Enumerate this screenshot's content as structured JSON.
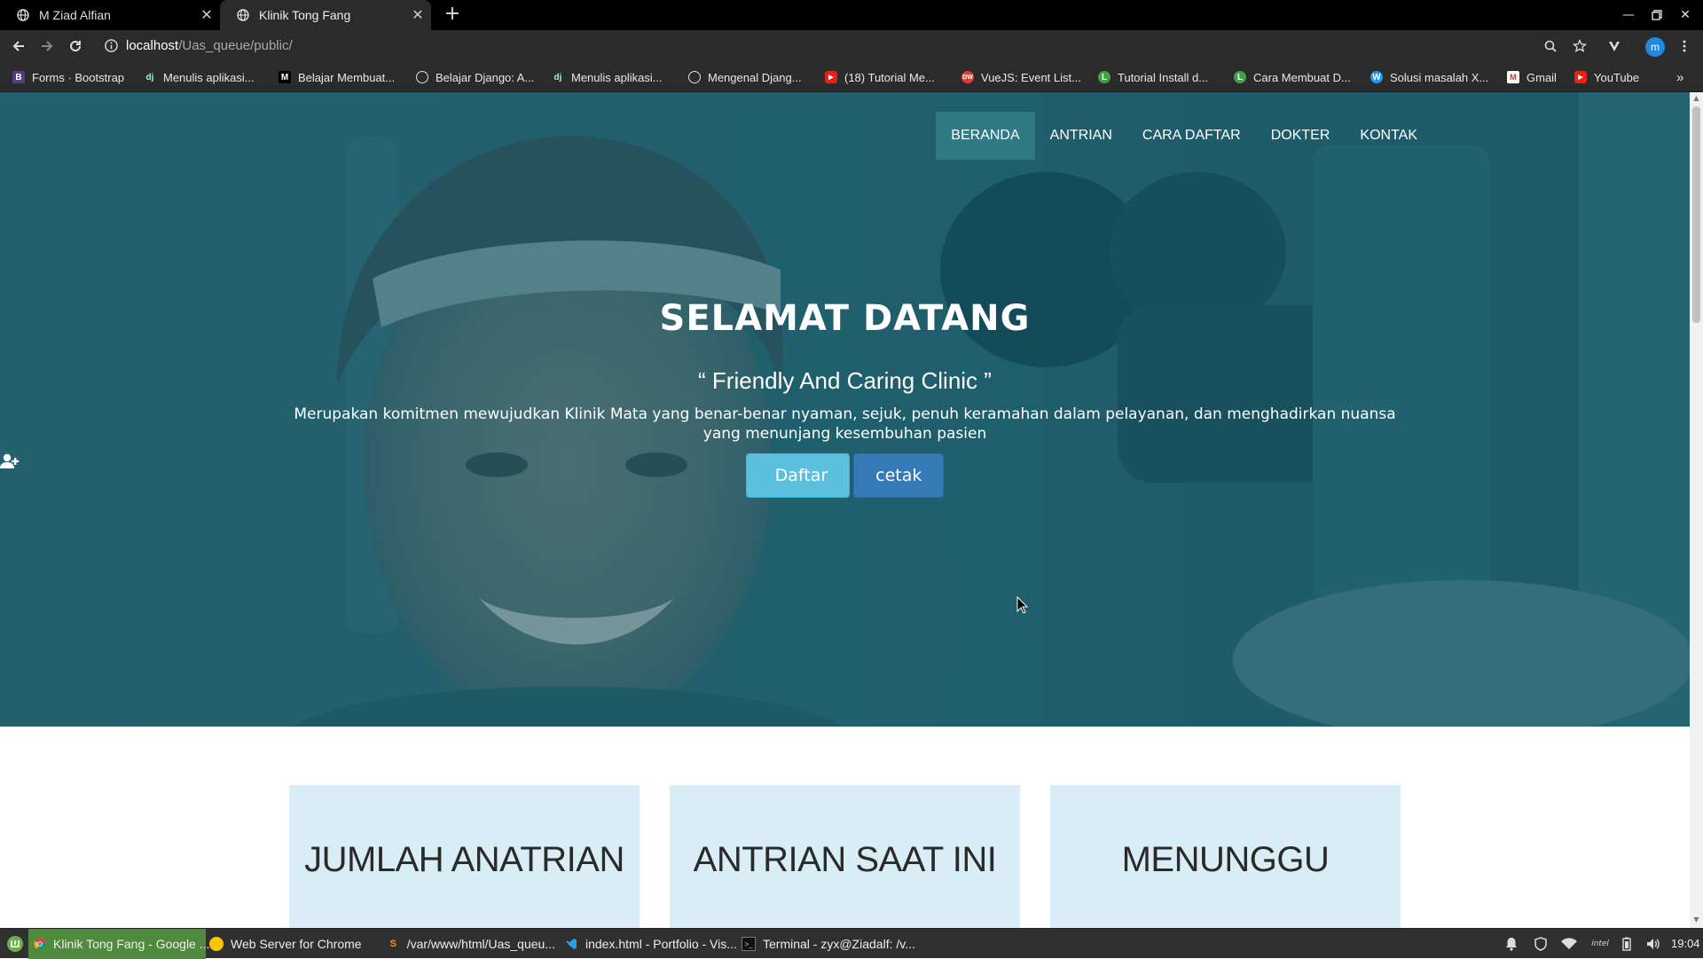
{
  "browser": {
    "tabs": [
      {
        "title": "M Ziad Alfian",
        "active": false
      },
      {
        "title": "Klinik Tong Fang",
        "active": true
      }
    ],
    "new_tab": "+",
    "url_host": "localhost",
    "url_path": "/Uas_queue/public/",
    "profile_initial": "m",
    "bookmarks": [
      {
        "label": "Forms · Bootstrap",
        "icon": "B"
      },
      {
        "label": "Menulis aplikasi...",
        "icon": "dj"
      },
      {
        "label": "Belajar Membuat...",
        "icon": "M"
      },
      {
        "label": "Belajar Django: A...",
        "icon": "globe"
      },
      {
        "label": "Menulis aplikasi...",
        "icon": "dj"
      },
      {
        "label": "Mengenal Djang...",
        "icon": "globe"
      },
      {
        "label": "(18) Tutorial Me...",
        "icon": "youtube"
      },
      {
        "label": "VueJS: Event List...",
        "icon": "DW"
      },
      {
        "label": "Tutorial Install d...",
        "icon": "L"
      },
      {
        "label": "Cara Membuat D...",
        "icon": "L"
      },
      {
        "label": "Solusi masalah X...",
        "icon": "W"
      },
      {
        "label": "Gmail",
        "icon": "gmail"
      },
      {
        "label": "YouTube",
        "icon": "youtube"
      }
    ],
    "bookmarks_more": "»"
  },
  "site": {
    "nav": [
      {
        "label": "BERANDA",
        "active": true
      },
      {
        "label": "ANTRIAN",
        "active": false
      },
      {
        "label": "CARA DAFTAR",
        "active": false
      },
      {
        "label": "DOKTER",
        "active": false
      },
      {
        "label": "KONTAK",
        "active": false
      }
    ],
    "hero": {
      "title": "SELAMAT DATANG",
      "subtitle": "“ Friendly And Caring Clinic ”",
      "description": "Merupakan komitmen mewujudkan Klinik Mata yang benar-benar nyaman, sejuk, penuh keramahan dalam pelayanan, dan menghadirkan nuansa yang menunjang kesembuhan pasien",
      "daftar_label": "Daftar",
      "cetak_label": "cetak"
    },
    "cards": [
      {
        "label": "JUMLAH ANATRIAN"
      },
      {
        "label": "ANTRIAN SAAT INI"
      },
      {
        "label": "MENUNGGU"
      }
    ]
  },
  "taskbar": {
    "items": [
      {
        "label": "Klinik Tong Fang - Google ...",
        "active": true
      },
      {
        "label": "Web Server for Chrome",
        "active": false
      },
      {
        "label": "/var/www/html/Uas_queu...",
        "active": false
      },
      {
        "label": "index.html - Portfolio - Vis...",
        "active": false
      },
      {
        "label": "Terminal - zyx@Ziadalf: /v...",
        "active": false
      }
    ],
    "clock": "19:04"
  },
  "colors": {
    "hero_overlay": "#1f6a78",
    "nav_active": "#2d7a82",
    "btn_daftar": "#5bc0de",
    "btn_cetak": "#337ab7",
    "card_bg": "#d9edf7"
  }
}
